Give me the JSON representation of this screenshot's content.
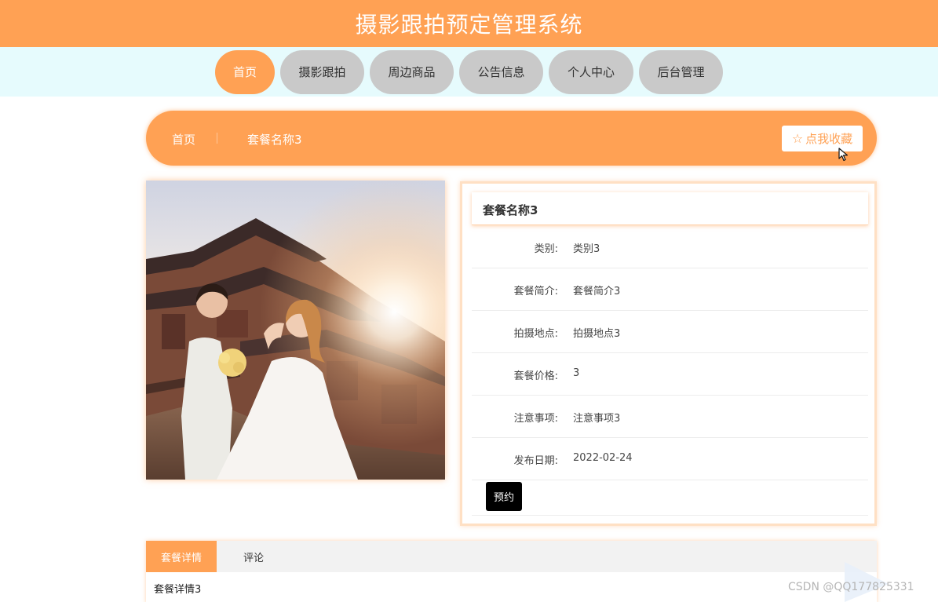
{
  "header": {
    "title": "摄影跟拍预定管理系统"
  },
  "nav": {
    "items": [
      {
        "label": "首页",
        "active": true
      },
      {
        "label": "摄影跟拍"
      },
      {
        "label": "周边商品"
      },
      {
        "label": "公告信息"
      },
      {
        "label": "个人中心"
      },
      {
        "label": "后台管理"
      }
    ]
  },
  "breadcrumb": {
    "home": "首页",
    "current": "套餐名称3",
    "favorite_label": "点我收藏"
  },
  "detail": {
    "title": "套餐名称3",
    "fields": [
      {
        "label": "类别:",
        "value": "类别3"
      },
      {
        "label": "套餐简介:",
        "value": "套餐简介3"
      },
      {
        "label": "拍摄地点:",
        "value": "拍摄地点3"
      },
      {
        "label": "套餐价格:",
        "value": "3"
      },
      {
        "label": "注意事项:",
        "value": "注意事项3"
      },
      {
        "label": "发布日期:",
        "value": "2022-02-24"
      }
    ],
    "book_label": "预约"
  },
  "tabs": {
    "items": [
      {
        "label": "套餐详情",
        "active": true
      },
      {
        "label": "评论"
      }
    ],
    "content": "套餐详情3"
  },
  "watermark": "CSDN @QQ177825331",
  "colors": {
    "accent": "#ffa154",
    "nav_inactive": "#c9c9c9",
    "nav_band": "#e6fbfd"
  }
}
